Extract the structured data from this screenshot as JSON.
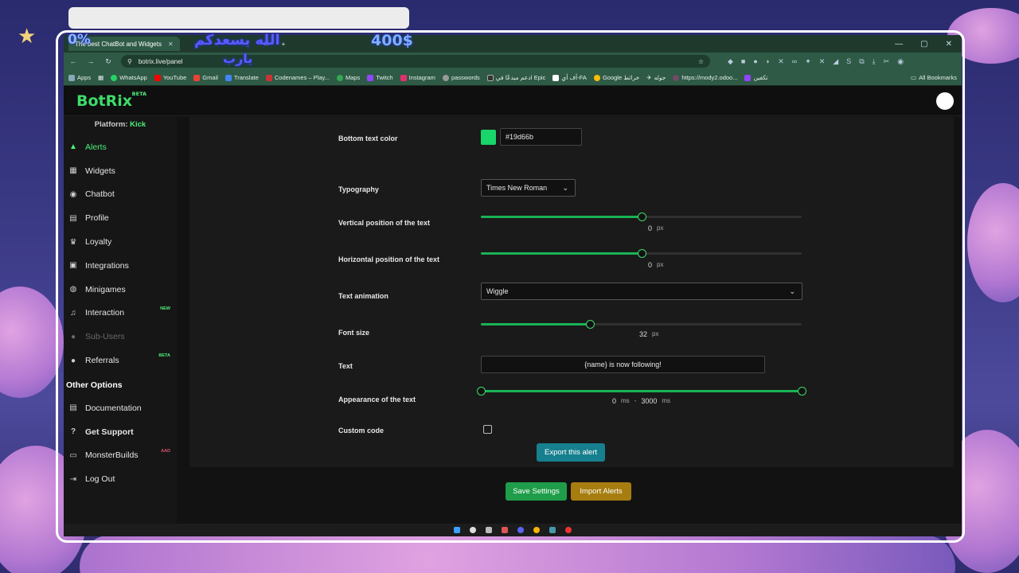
{
  "overlay": {
    "price": "400$",
    "arabic_line1": "الله يسعدكم",
    "arabic_line2": "يارب",
    "badge": "0%"
  },
  "browser": {
    "tabs": [
      {
        "title": "The best ChatBot and Widgets",
        "active": true
      },
      {
        "title": "",
        "active": false
      }
    ],
    "url": "botrix.live/panel",
    "bookmarks": [
      "Apps",
      "WhatsApp",
      "YouTube",
      "Gmail",
      "Translate",
      "Codenames – Play...",
      "Maps",
      "Twitch",
      "Instagram",
      "passwords",
      "ادعم مبدعًا في Epic",
      "أف أي-FA",
      "Google خرائط",
      "جوله",
      "https://mody2.odoo...",
      "تكفين"
    ],
    "all_bookmarks": "All Bookmarks"
  },
  "app": {
    "logo": "BotRix",
    "logo_badge": "BETA",
    "platform_label": "Platform:",
    "platform_value": "Kick"
  },
  "sidebar": {
    "items": [
      {
        "label": "Alerts",
        "icon": "warning-icon",
        "glyph": "▲",
        "active": true
      },
      {
        "label": "Widgets",
        "icon": "widgets-icon",
        "glyph": "▦"
      },
      {
        "label": "Chatbot",
        "icon": "robot-icon",
        "glyph": "◉"
      },
      {
        "label": "Profile",
        "icon": "id-card-icon",
        "glyph": "▤"
      },
      {
        "label": "Loyalty",
        "icon": "trophy-icon",
        "glyph": "♛"
      },
      {
        "label": "Integrations",
        "icon": "integrations-icon",
        "glyph": "▣"
      },
      {
        "label": "Minigames",
        "icon": "gamepad-icon",
        "glyph": "◍"
      },
      {
        "label": "Interaction",
        "icon": "music-icon",
        "glyph": "♫",
        "badge": "NEW"
      },
      {
        "label": "Sub-Users",
        "icon": "users-icon",
        "glyph": "●",
        "disabled": true
      },
      {
        "label": "Referrals",
        "icon": "referrals-icon",
        "glyph": "●",
        "badge": "BETA"
      }
    ],
    "other_options_label": "Other Options",
    "other_items": [
      {
        "label": "Documentation",
        "icon": "document-icon",
        "glyph": "▤"
      },
      {
        "label": "Get Support",
        "icon": "help-icon",
        "glyph": "?",
        "bold": true
      },
      {
        "label": "MonsterBuilds",
        "icon": "monitor-icon",
        "glyph": "▭",
        "badge": "AAD"
      },
      {
        "label": "Log Out",
        "icon": "logout-icon",
        "glyph": "⇥"
      }
    ]
  },
  "form": {
    "bottom_text_color_label": "Bottom text color",
    "bottom_text_color_value": "#19d66b",
    "swatch_color": "#19d66b",
    "typography_label": "Typography",
    "typography_value": "Times New Roman",
    "vertical_label": "Vertical position of the text",
    "vertical_value": "0",
    "vertical_fraction": 0.5,
    "horizontal_label": "Horizontal position of the text",
    "horizontal_value": "0",
    "horizontal_fraction": 0.5,
    "px_unit": "px",
    "animation_label": "Text animation",
    "animation_value": "Wiggle",
    "font_size_label": "Font size",
    "font_size_value": "32",
    "font_size_fraction": 0.34,
    "text_label": "Text",
    "text_value": "{name} is now following!",
    "appearance_label": "Appearance of the text",
    "appearance_start": "0",
    "appearance_end": "3000",
    "ms_unit": "ms",
    "dash": "-",
    "custom_code_label": "Custom code",
    "export_button": "Export this alert",
    "save_button": "Save Settings",
    "import_button": "Import Alerts"
  }
}
